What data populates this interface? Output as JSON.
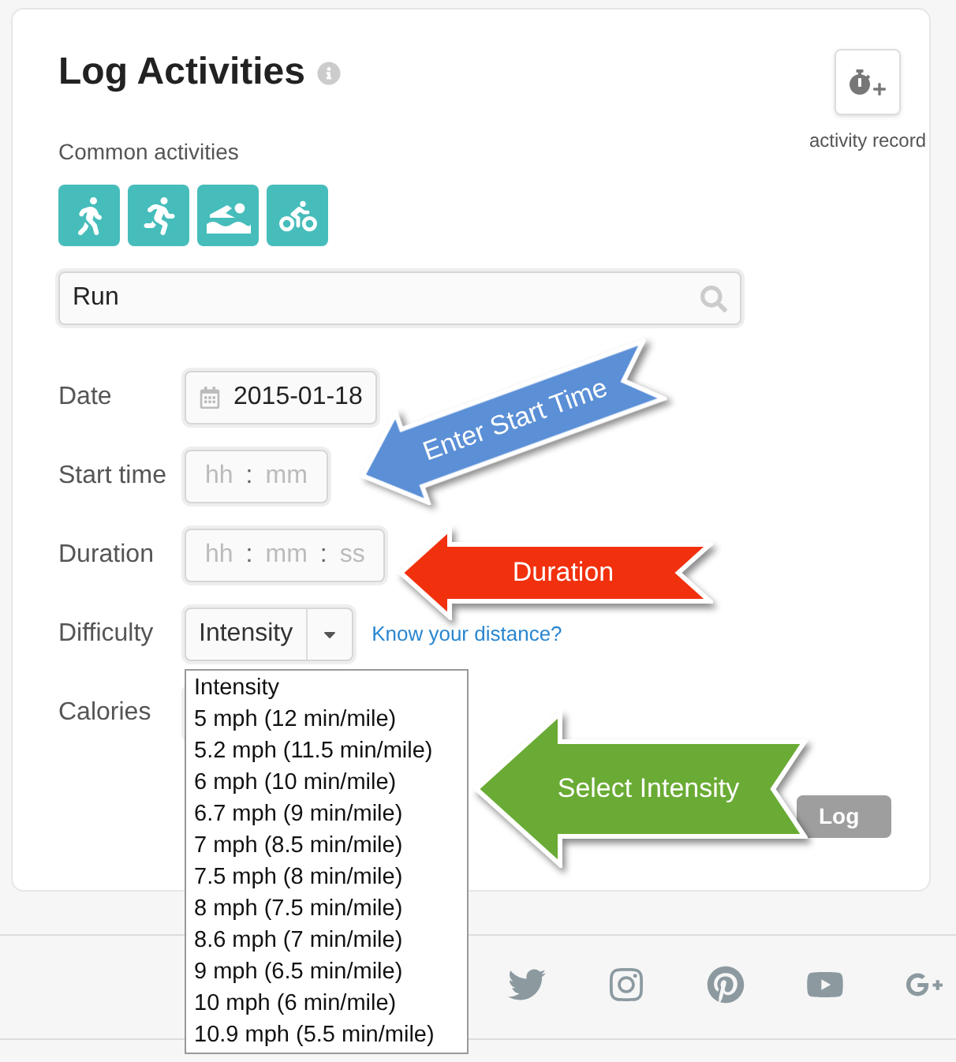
{
  "title": "Log Activities",
  "record_button": {
    "label": "activity record"
  },
  "common_activities": {
    "label": "Common activities"
  },
  "search": {
    "value": "Run"
  },
  "form": [
    {
      "kind": "date",
      "label": "Date",
      "value": "2015-01-18"
    },
    {
      "kind": "time",
      "label": "Start time",
      "parts": [
        "hh",
        ":",
        "mm"
      ]
    },
    {
      "kind": "time",
      "label": "Duration",
      "parts": [
        "hh",
        ":",
        "mm",
        ":",
        "ss"
      ]
    },
    {
      "kind": "select",
      "label": "Difficulty",
      "value": "Intensity",
      "link": "Know your distance?"
    },
    {
      "kind": "empty",
      "label": "Calories"
    }
  ],
  "dropdown": {
    "options": [
      {
        "label": "Intensity",
        "selected": false
      },
      {
        "label": "5 mph (12 min/mile)",
        "selected": false
      },
      {
        "label": "5.2 mph (11.5 min/mile)",
        "selected": false
      },
      {
        "label": "6 mph (10 min/mile)",
        "selected": false
      },
      {
        "label": "6.7 mph (9 min/mile)",
        "selected": false
      },
      {
        "label": "7 mph (8.5 min/mile)",
        "selected": false
      },
      {
        "label": "7.5 mph (8 min/mile)",
        "selected": false
      },
      {
        "label": "8 mph (7.5 min/mile)",
        "selected": false
      },
      {
        "label": "8.6 mph (7 min/mile)",
        "selected": false
      },
      {
        "label": "9 mph (6.5 min/mile)",
        "selected": false
      },
      {
        "label": "10 mph (6 min/mile)",
        "selected": false
      },
      {
        "label": "10.9 mph (5.5 min/mile)",
        "selected": false
      }
    ]
  },
  "log_button": "Log",
  "annotations": [
    {
      "text": "Enter Start Time",
      "color": "#5b8fd6"
    },
    {
      "text": "Duration",
      "color": "#f1300e"
    },
    {
      "text": "Select Intensity",
      "color": "#6aab35"
    }
  ]
}
